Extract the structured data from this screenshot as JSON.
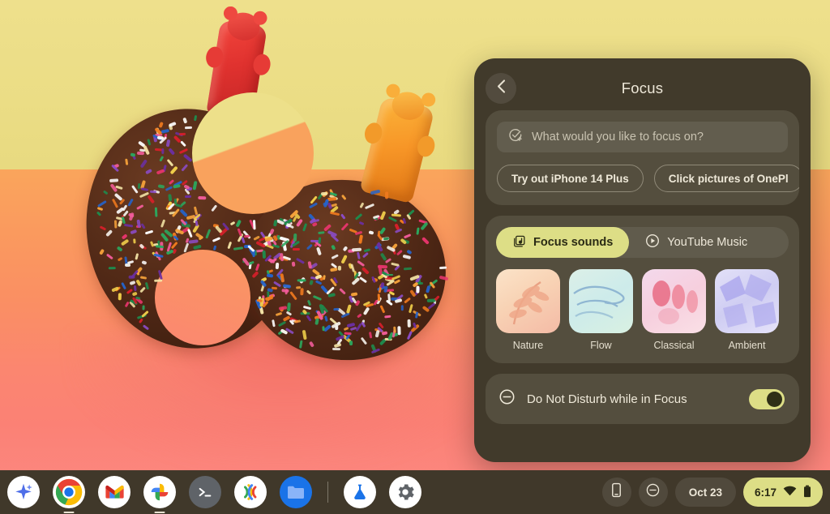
{
  "wallpaper": {
    "description": "sprinkle-covered chocolate donut with gummy bears on yellow and orange background",
    "top_color": "#EDE08A",
    "bottom_color": "#FA8F63"
  },
  "focus_panel": {
    "title": "Focus",
    "back_icon": "chevron-left-icon",
    "task": {
      "icon": "check-circle-plus-icon",
      "placeholder": "What would you like to focus on?",
      "value": "",
      "chips": [
        {
          "label": "Try out iPhone 14 Plus"
        },
        {
          "label": "Click pictures of OnePl"
        }
      ]
    },
    "sounds": {
      "tabs": [
        {
          "label": "Focus sounds",
          "icon": "music-library-icon",
          "selected": true
        },
        {
          "label": "YouTube Music",
          "icon": "play-circle-icon",
          "selected": false
        }
      ],
      "tiles": [
        {
          "label": "Nature"
        },
        {
          "label": "Flow"
        },
        {
          "label": "Classical"
        },
        {
          "label": "Ambient"
        }
      ]
    },
    "do_not_disturb": {
      "icon": "do-not-disturb-icon",
      "label": "Do Not Disturb while in Focus",
      "enabled": true
    },
    "accent_color": "#DDDE86",
    "panel_color": "#413A2B",
    "card_color": "#544E3E"
  },
  "shelf": {
    "apps": [
      {
        "name": "launcher",
        "icon": "sparkle-icon",
        "running": false
      },
      {
        "name": "chrome",
        "icon": "chrome-icon",
        "running": true
      },
      {
        "name": "gmail",
        "icon": "gmail-icon",
        "running": false
      },
      {
        "name": "photos",
        "icon": "photos-icon",
        "running": true
      },
      {
        "name": "terminal",
        "icon": "terminal-icon",
        "running": false
      },
      {
        "name": "meet",
        "icon": "meet-icon",
        "running": false
      },
      {
        "name": "files",
        "icon": "files-icon",
        "running": false
      },
      {
        "name": "crostini",
        "icon": "beaker-icon",
        "running": false
      },
      {
        "name": "settings",
        "icon": "gear-icon",
        "running": false
      }
    ],
    "status": {
      "phone_hub_icon": "phone-icon",
      "dnd_icon": "do-not-disturb-icon",
      "date": "Oct 23",
      "time": "6:17",
      "network_icon": "wifi-icon",
      "battery_icon": "battery-full-icon"
    }
  }
}
